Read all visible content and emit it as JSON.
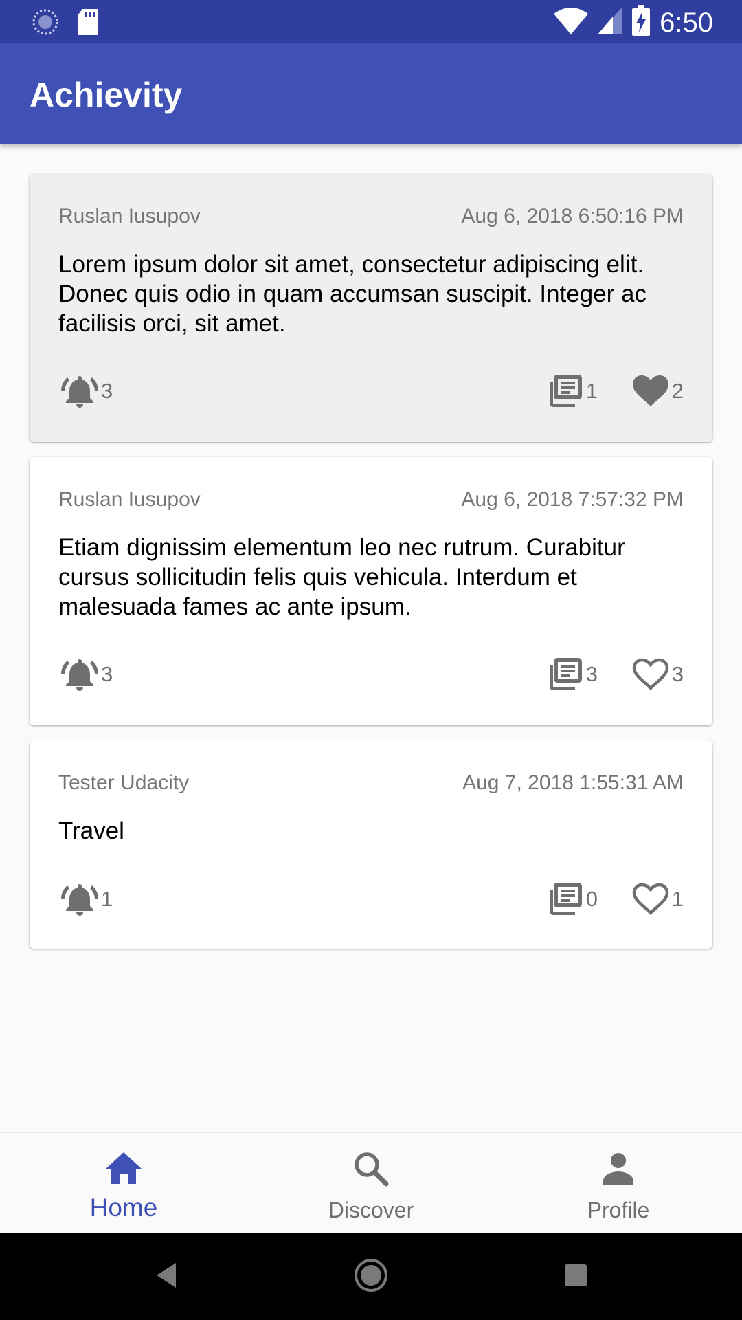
{
  "status_bar": {
    "time": "6:50",
    "icons": [
      "sync-icon",
      "sd-card-icon",
      "wifi-icon",
      "cell-signal-icon",
      "battery-charging-icon"
    ]
  },
  "app_bar": {
    "title": "Achievity"
  },
  "feed": {
    "cards": [
      {
        "author": "Ruslan Iusupov",
        "timestamp": "Aug 6, 2018 6:50:16 PM",
        "text": "Lorem ipsum dolor sit amet, consectetur adipiscing elit. Donec quis odio in quam accumsan suscipit. Integer ac facilisis orci, sit amet.",
        "reminders": "3",
        "posts": "1",
        "likes": "2",
        "liked": true
      },
      {
        "author": "Ruslan Iusupov",
        "timestamp": "Aug 6, 2018 7:57:32 PM",
        "text": "Etiam dignissim elementum leo nec rutrum. Curabitur cursus sollicitudin felis quis vehicula. Interdum et malesuada fames ac ante ipsum.",
        "reminders": "3",
        "posts": "3",
        "likes": "3",
        "liked": false
      },
      {
        "author": "Tester Udacity",
        "timestamp": "Aug 7, 2018 1:55:31 AM",
        "text": "Travel",
        "reminders": "1",
        "posts": "0",
        "likes": "1",
        "liked": false
      }
    ]
  },
  "bottom_nav": {
    "items": [
      {
        "label": "Home",
        "icon": "home-icon",
        "active": true
      },
      {
        "label": "Discover",
        "icon": "search-icon",
        "active": false
      },
      {
        "label": "Profile",
        "icon": "person-icon",
        "active": false
      }
    ]
  },
  "colors": {
    "status_bar": "#303f9f",
    "primary": "#3f51b5",
    "icon_gray": "#6f6f6f",
    "selected_card": "#efefef"
  }
}
